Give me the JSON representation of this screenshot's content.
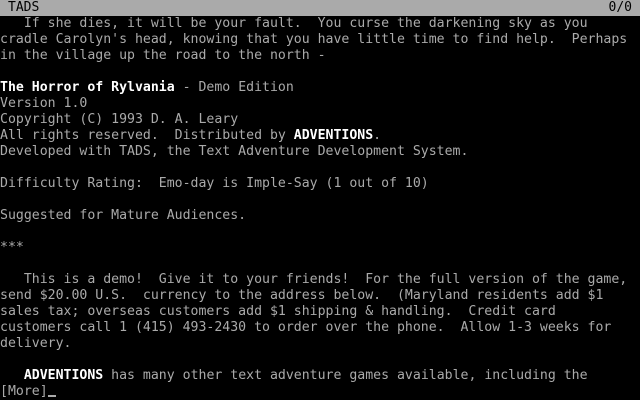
{
  "status_bar": {
    "title": "TADS",
    "score": "0/0"
  },
  "text": {
    "intro_1": "   If she dies, it will be your fault.  You curse the darkening sky as you",
    "intro_2": "cradle Carolyn's head, knowing that you have little time to find help.  Perhaps",
    "intro_3": "in the village up the road to the north -",
    "game_title": "The Horror of Rylvania",
    "edition": " - Demo Edition",
    "version": "Version 1.0",
    "copyright": "Copyright (C) 1993 D. A. Leary",
    "rights_prefix": "All rights reserved.  Distributed by ",
    "publisher": "ADVENTIONS",
    "rights_suffix": ".",
    "developed": "Developed with TADS, the Text Adventure Development System.",
    "difficulty": "Difficulty Rating:  Emo-day is Imple-Say (1 out of 10)",
    "audience": "Suggested for Mature Audiences.",
    "separator": "***",
    "demo_1": "   This is a demo!  Give it to your friends!  For the full version of the game,",
    "demo_2": "send $20.00 U.S.  currency to the address below.  (Maryland residents add $1",
    "demo_3": "sales tax; overseas customers add $1 shipping & handling.  Credit card",
    "demo_4": "customers call 1 (415) 493-2430 to order over the phone.  Allow 1-3 weeks for",
    "demo_5": "delivery.",
    "more_games_indent": "   ",
    "more_games_publisher": "ADVENTIONS",
    "more_games_rest": " has many other text adventure games available, including the",
    "more_prompt": "[More]"
  },
  "colors": {
    "background": "#000000",
    "text": "#aaaaaa",
    "highlight": "#ffffff",
    "status_bar": "#aaaaaa"
  }
}
